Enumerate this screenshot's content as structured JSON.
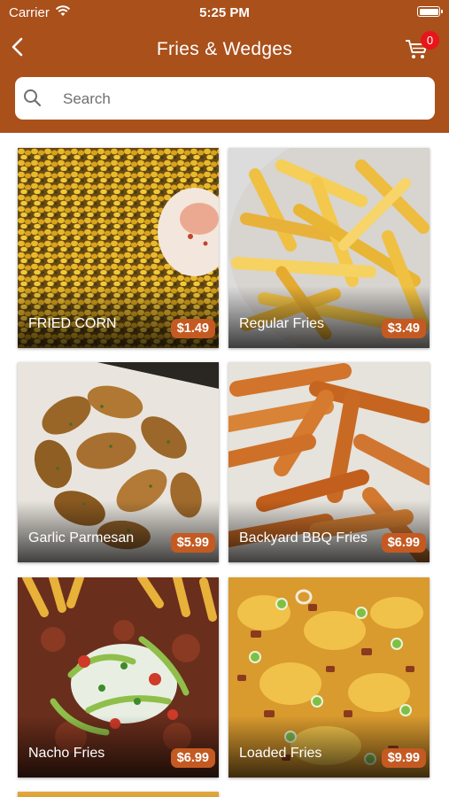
{
  "status_bar": {
    "carrier": "Carrier",
    "time": "5:25 PM"
  },
  "nav": {
    "title": "Fries & Wedges",
    "cart_count": "0"
  },
  "search": {
    "placeholder": "Search",
    "value": ""
  },
  "colors": {
    "header": "#a9501b",
    "price_badge": "#c45a22",
    "cart_badge": "#e8151b"
  },
  "icons": [
    "wifi-icon",
    "battery-icon",
    "back-icon",
    "cart-icon",
    "search-icon"
  ],
  "products": [
    {
      "name": "FRIED CORN",
      "price": "$1.49"
    },
    {
      "name": "Regular Fries",
      "price": "$3.49"
    },
    {
      "name": "Garlic Parmesan",
      "price": "$5.99"
    },
    {
      "name": "Backyard BBQ Fries",
      "price": "$6.99"
    },
    {
      "name": "Nacho Fries",
      "price": "$6.99"
    },
    {
      "name": "Loaded Fries",
      "price": "$9.99"
    }
  ]
}
